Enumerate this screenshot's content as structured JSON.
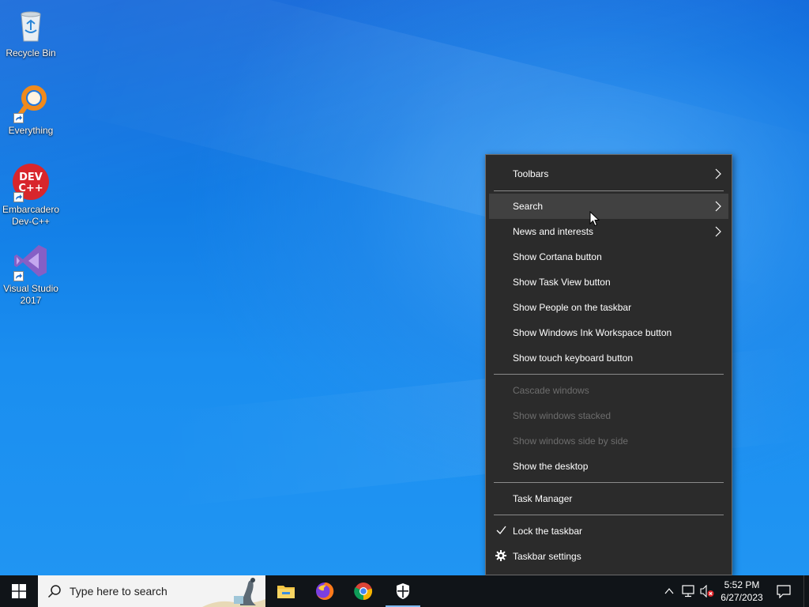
{
  "desktop": {
    "icons": [
      {
        "label": "Recycle Bin"
      },
      {
        "label": "Everything"
      },
      {
        "label": "Embarcadero Dev-C++",
        "badge": "DEV\nC++"
      },
      {
        "label": "Visual Studio 2017"
      }
    ]
  },
  "context_menu": {
    "items": [
      {
        "label": "Toolbars",
        "submenu": true,
        "enabled": true
      },
      {
        "label": "Search",
        "submenu": true,
        "enabled": true,
        "hovered": true
      },
      {
        "label": "News and interests",
        "submenu": true,
        "enabled": true
      },
      {
        "label": "Show Cortana button",
        "enabled": true
      },
      {
        "label": "Show Task View button",
        "enabled": true
      },
      {
        "label": "Show People on the taskbar",
        "enabled": true
      },
      {
        "label": "Show Windows Ink Workspace button",
        "enabled": true
      },
      {
        "label": "Show touch keyboard button",
        "enabled": true
      },
      {
        "label": "Cascade windows",
        "enabled": false
      },
      {
        "label": "Show windows stacked",
        "enabled": false
      },
      {
        "label": "Show windows side by side",
        "enabled": false
      },
      {
        "label": "Show the desktop",
        "enabled": true
      },
      {
        "label": "Task Manager",
        "enabled": true
      },
      {
        "label": "Lock the taskbar",
        "enabled": true,
        "checked": true
      },
      {
        "label": "Taskbar settings",
        "enabled": true,
        "icon": "gear-icon"
      }
    ]
  },
  "taskbar": {
    "search_placeholder": "Type here to search",
    "pinned_apps": [
      "file-explorer-icon",
      "firefox-icon",
      "chrome-icon",
      "windows-security-icon"
    ],
    "active_app": "windows-security-icon",
    "tray_icons": [
      "chevron-up-icon",
      "network-icon",
      "volume-muted-icon"
    ],
    "clock": {
      "time": "5:52 PM",
      "date": "6/27/2023"
    }
  },
  "colors": {
    "menu_bg": "#2b2b2b",
    "menu_hover": "#414141",
    "menu_disabled_text": "#6d6d6d",
    "taskbar_bg": "#101418",
    "desktop_blue": "#1a8ef0"
  }
}
